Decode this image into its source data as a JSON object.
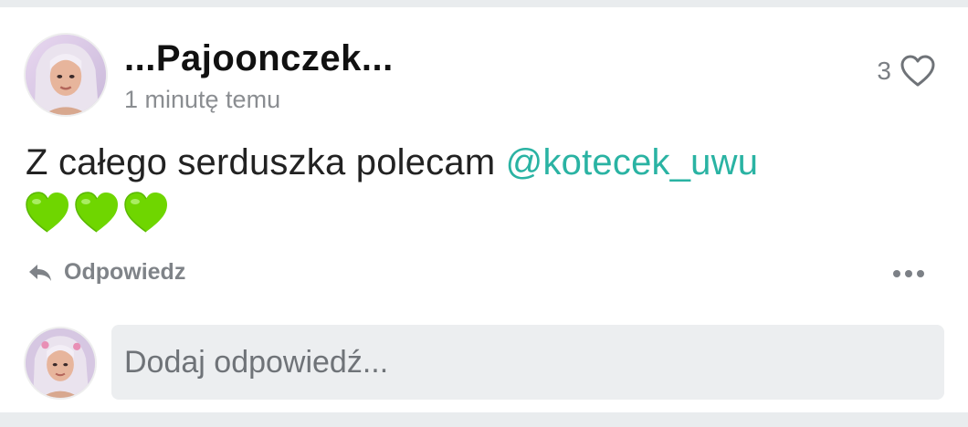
{
  "comment": {
    "author": "...Pajoonczek...",
    "timestamp": "1 minutę temu",
    "like_count": "3",
    "text": "Z całego serduszka polecam ",
    "mention": "@kotecek_uwu",
    "emoji": [
      "green-heart",
      "green-heart",
      "green-heart"
    ],
    "reply_label": "Odpowiedz"
  },
  "reply_box": {
    "placeholder": "Dodaj odpowiedź..."
  },
  "colors": {
    "mention": "#2ab3a3",
    "heart_emoji": "#6fd600",
    "muted_text": "#8a8d91",
    "input_bg": "#eceef0"
  },
  "icons": [
    "heart-outline-icon",
    "reply-arrow-icon",
    "more-dots-icon"
  ]
}
